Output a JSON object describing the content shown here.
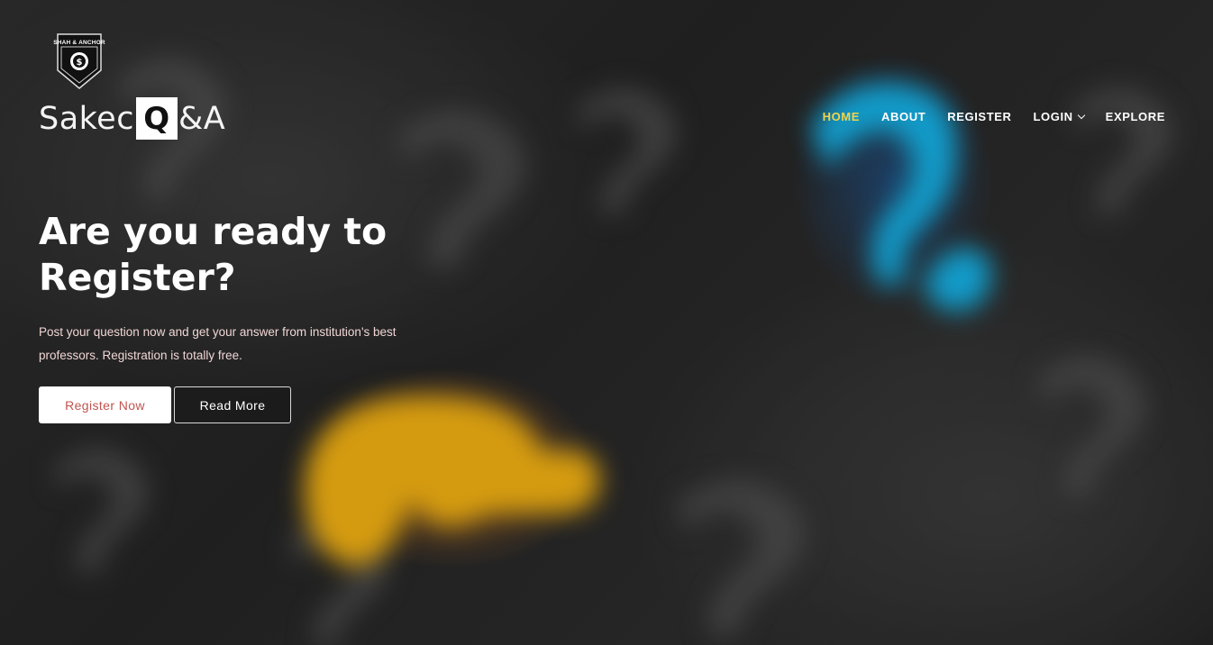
{
  "brand": {
    "emblem_text": "SHAH & ANCHOR",
    "name_prefix": "Sakec",
    "name_highlight": "Q",
    "name_suffix": "&A"
  },
  "nav": {
    "items": [
      {
        "label": "HOME",
        "active": true
      },
      {
        "label": "ABOUT",
        "active": false
      },
      {
        "label": "REGISTER",
        "active": false
      },
      {
        "label": "LOGIN",
        "active": false,
        "has_dropdown": true
      },
      {
        "label": "EXPLORE",
        "active": false
      }
    ]
  },
  "hero": {
    "headline": "Are you ready to Register?",
    "subtext": "Post your question now and get your answer from institution's best professors. Registration is totally free.",
    "primary_button": "Register Now",
    "secondary_button": "Read More"
  },
  "colors": {
    "nav_active": "#f2d44a",
    "primary_button_text": "#c0544f",
    "subtext": "#f1d6d6"
  },
  "icons": {
    "emblem": "shield-emblem-icon",
    "login_dropdown": "chevron-down-icon"
  }
}
